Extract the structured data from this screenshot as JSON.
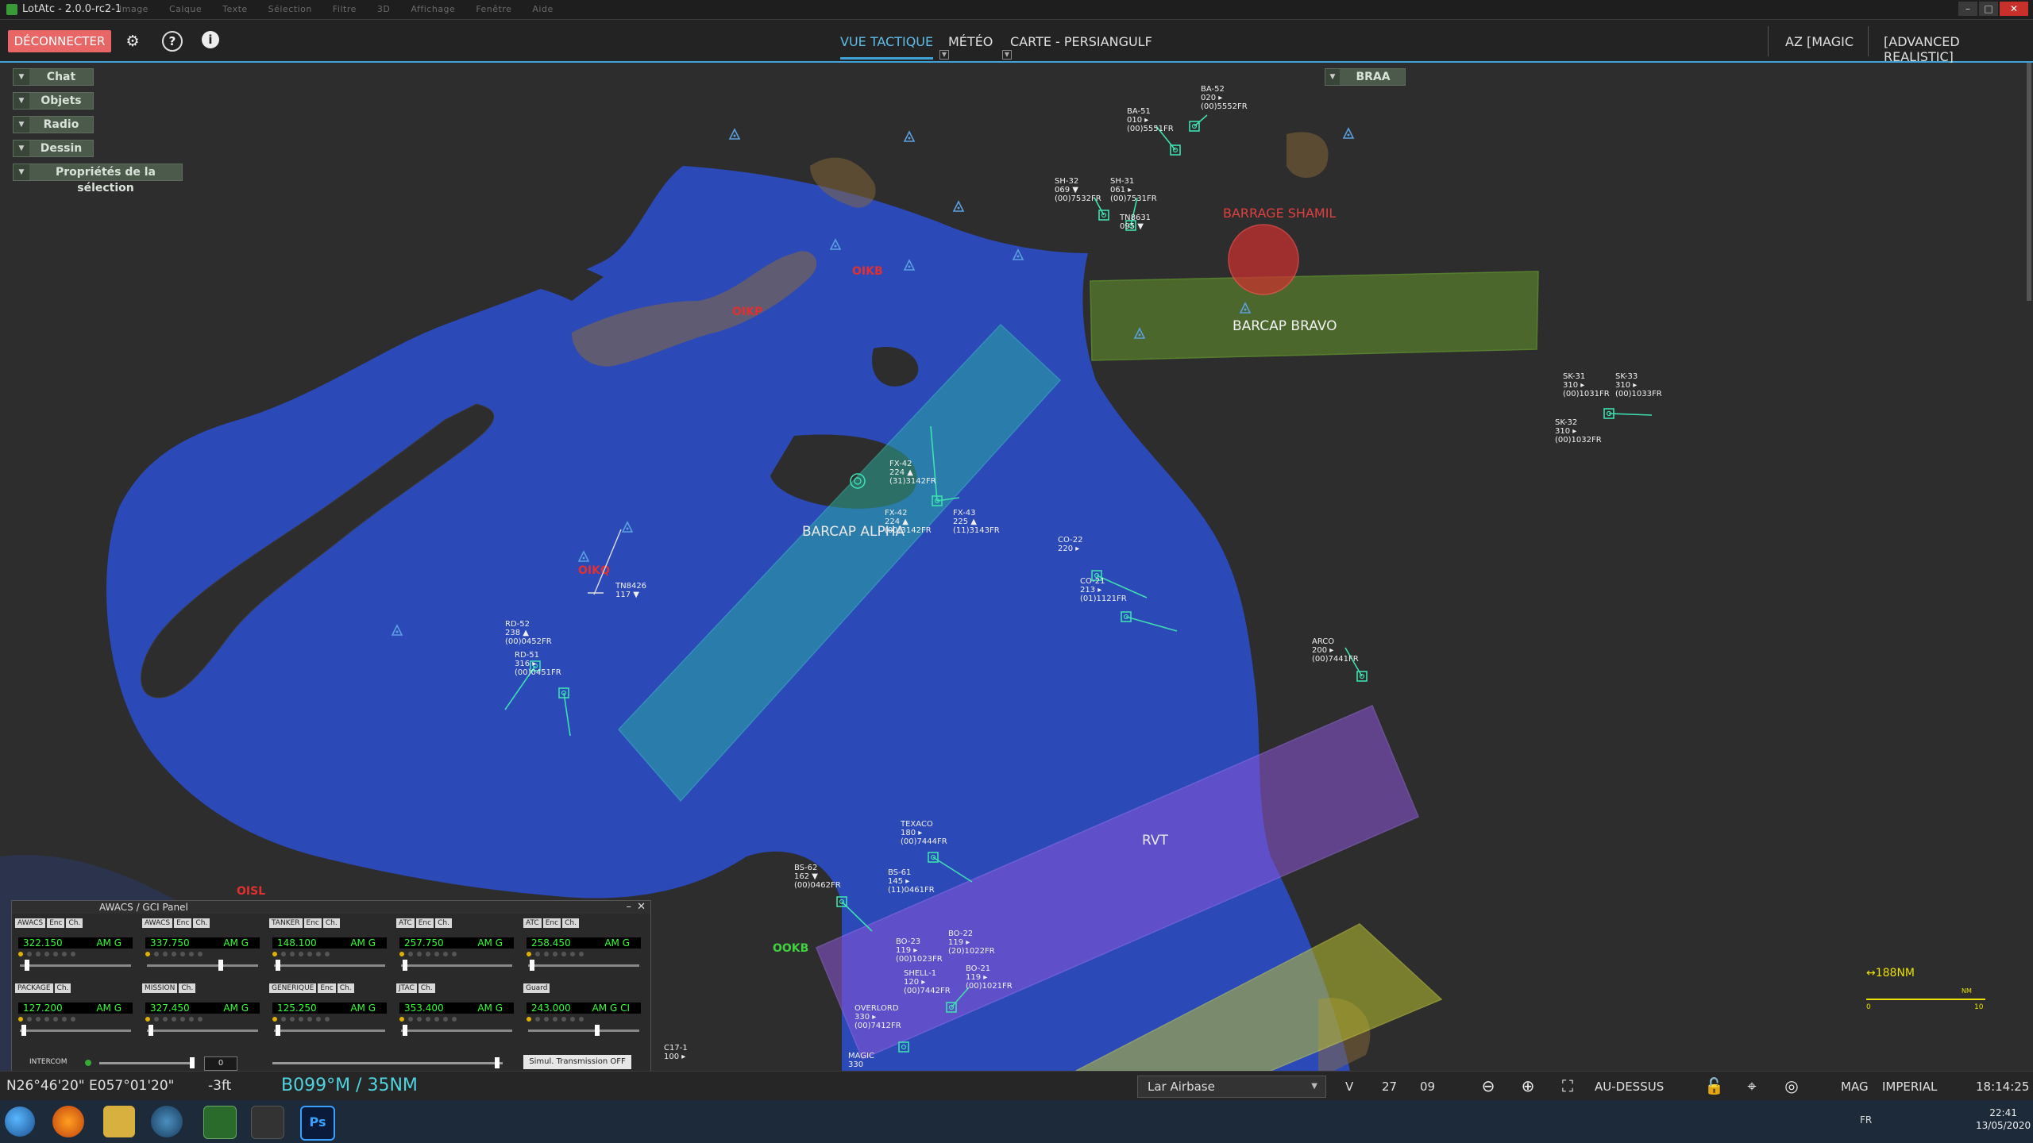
{
  "window": {
    "title": "LotAtc - 2.0.0-rc2-1",
    "menus": [
      "Image",
      "Calque",
      "Texte",
      "Sélection",
      "Filtre",
      "3D",
      "Affichage",
      "Fenêtre",
      "Aide"
    ],
    "minimize": "–",
    "maximize": "□",
    "close": "✕"
  },
  "topbar": {
    "disconnect": "DÉCONNECTER",
    "gear": "⚙",
    "help": "?",
    "info": "i",
    "tabs": [
      {
        "label": "VUE TACTIQUE"
      },
      {
        "label": "MÉTÉO"
      },
      {
        "label": "CARTE - PERSIANGULF"
      }
    ],
    "dd_glyph": "▼",
    "az": "AZ [MAGIC",
    "mode": "[ADVANCED REALISTIC]"
  },
  "left_panels": [
    {
      "label": "Chat"
    },
    {
      "label": "Objets"
    },
    {
      "label": "Radio"
    },
    {
      "label": "Dessin"
    },
    {
      "label": "Propriétés de la sélection"
    }
  ],
  "panel_arrow": "▼",
  "braa": {
    "label": "BRAA"
  },
  "map": {
    "zones": {
      "barcap_bravo": "BARCAP BRAVO",
      "barcap_alpha": "BARCAP ALPHA",
      "rvt": "RVT",
      "barrage": "BARRAGE SHAMIL"
    },
    "airports": [
      "OIKB",
      "OIKP",
      "OIKQ",
      "OISL",
      "OOKB"
    ],
    "scale": {
      "label": "↔188NM",
      "unit": "NM",
      "zero": "0",
      "ten": "10"
    },
    "tracks": [
      {
        "lines": [
          "BA-52",
          "020 ▸",
          "(00)5552FR"
        ]
      },
      {
        "lines": [
          "BA-51",
          "010 ▸",
          "(00)5551FR"
        ]
      },
      {
        "lines": [
          "SH-32",
          "069 ▼",
          "(00)7532FR"
        ]
      },
      {
        "lines": [
          "SH-31",
          "061 ▸",
          "(00)7531FR"
        ]
      },
      {
        "lines": [
          "TN8631",
          "095 ▼"
        ]
      },
      {
        "lines": [
          "SK-31",
          "310 ▸",
          "(00)1031FR"
        ]
      },
      {
        "lines": [
          "SK-33",
          "310 ▸",
          "(00)1033FR"
        ]
      },
      {
        "lines": [
          "SK-32",
          "310 ▸",
          "(00)1032FR"
        ]
      },
      {
        "lines": [
          "FX-42",
          "224 ▲",
          "(31)3142FR"
        ]
      },
      {
        "lines": [
          "FX-42",
          "224 ▲",
          "(00)3142FR"
        ]
      },
      {
        "lines": [
          "FX-43",
          "225 ▲",
          "(11)3143FR"
        ]
      },
      {
        "lines": [
          "CO-22",
          "220 ▸"
        ]
      },
      {
        "lines": [
          "CO-21",
          "213 ▸",
          "(01)1121FR"
        ]
      },
      {
        "lines": [
          "ARCO",
          "200 ▸",
          "(00)7441FR"
        ]
      },
      {
        "lines": [
          "TN8426",
          "117 ▼"
        ]
      },
      {
        "lines": [
          "RD-52",
          "238 ▲",
          "(00)0452FR"
        ]
      },
      {
        "lines": [
          "RD-51",
          "316 ▸",
          "(00)0451FR"
        ]
      },
      {
        "lines": [
          "TEXACO",
          "180 ▸",
          "(00)7444FR"
        ]
      },
      {
        "lines": [
          "BS-62",
          "162 ▼",
          "(00)0462FR"
        ]
      },
      {
        "lines": [
          "BS-61",
          "145 ▸",
          "(11)0461FR"
        ]
      },
      {
        "lines": [
          "BO-23",
          "119 ▸",
          "(00)1023FR"
        ]
      },
      {
        "lines": [
          "BO-22",
          "119 ▸",
          "(20)1022FR"
        ]
      },
      {
        "lines": [
          "SHELL-1",
          "120 ▸",
          "(00)7442FR"
        ]
      },
      {
        "lines": [
          "BO-21",
          "119 ▸",
          "(00)1021FR"
        ]
      },
      {
        "lines": [
          "OVERLORD",
          "330 ▸",
          "(00)7412FR"
        ]
      },
      {
        "lines": [
          "C17-1",
          "100 ▸"
        ]
      },
      {
        "lines": [
          "MAGIC",
          "330"
        ]
      }
    ]
  },
  "awacs": {
    "title": "AWACS / GCI Panel",
    "min_glyph": "–",
    "close_glyph": "✕",
    "radios": [
      {
        "tags": [
          "AWACS",
          "Enc",
          "Ch."
        ],
        "freq": "322.150",
        "mode": "AM G"
      },
      {
        "tags": [
          "AWACS",
          "Enc",
          "Ch."
        ],
        "freq": "337.750",
        "mode": "AM G"
      },
      {
        "tags": [
          "TANKER",
          "Enc",
          "Ch."
        ],
        "freq": "148.100",
        "mode": "AM G"
      },
      {
        "tags": [
          "ATC",
          "Enc",
          "Ch."
        ],
        "freq": "257.750",
        "mode": "AM G"
      },
      {
        "tags": [
          "ATC",
          "Enc",
          "Ch."
        ],
        "freq": "258.450",
        "mode": "AM G"
      },
      {
        "tags": [
          "PACKAGE",
          "Ch."
        ],
        "freq": "127.200",
        "mode": "AM G"
      },
      {
        "tags": [
          "MISSION",
          "Ch."
        ],
        "freq": "327.450",
        "mode": "AM G"
      },
      {
        "tags": [
          "GENERIQUE",
          "Enc",
          "Ch."
        ],
        "freq": "125.250",
        "mode": "AM G"
      },
      {
        "tags": [
          "JTAC",
          "Ch."
        ],
        "freq": "353.400",
        "mode": "AM G"
      },
      {
        "tags": [
          "Guard"
        ],
        "freq": "243.000",
        "mode": "AM G CI"
      }
    ],
    "intercom": "INTERCOM",
    "intercom_value": "0",
    "transmission": "Simul. Transmission OFF"
  },
  "status": {
    "coords": "N26°46'20\" E057°01'20\"",
    "alt": "-3ft",
    "bearing": "B099°M / 35NM",
    "airbase": "Lar Airbase",
    "sel_glyph": "▼",
    "v": "V",
    "n1": "27",
    "n2": "09",
    "zoom_out": "⊖",
    "zoom_in": "⊕",
    "fullscreen": "⛶",
    "view": "AU-DESSUS",
    "lock": "🔓",
    "crosshair": "⌖",
    "target": "◎",
    "mag": "MAG",
    "units": "IMPERIAL",
    "time": "18:14:25"
  },
  "taskbar": {
    "lang": "FR",
    "time": "22:41",
    "date": "13/05/2020",
    "ps": "Ps"
  }
}
